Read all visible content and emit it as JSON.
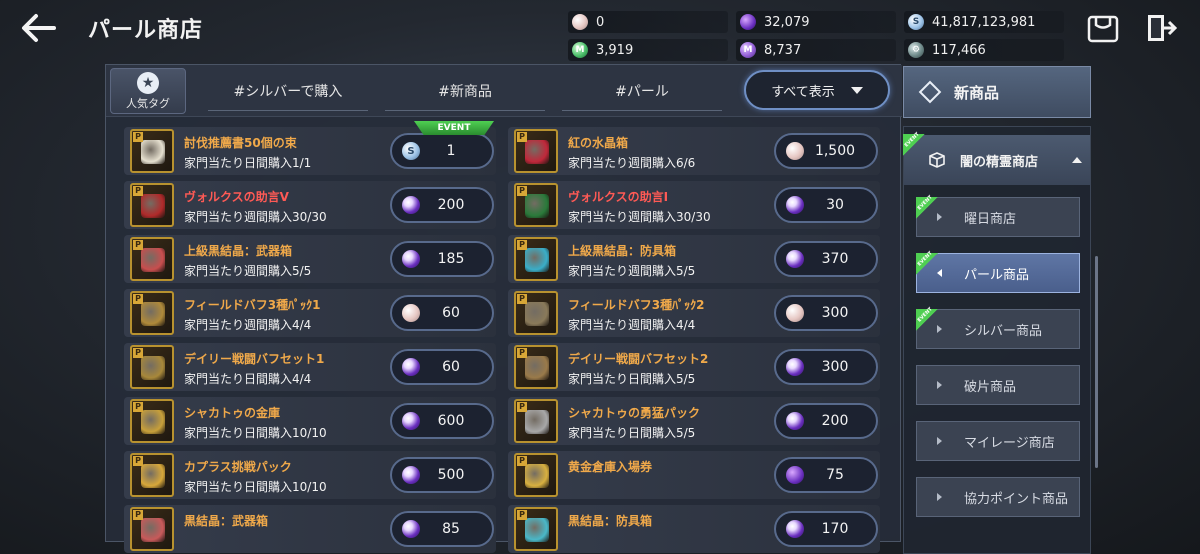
{
  "header": {
    "title": "パール商店",
    "currencies": [
      {
        "icon": "pearl-icon",
        "value": "0"
      },
      {
        "icon": "dark-crystal-icon",
        "value": "32,079"
      },
      {
        "icon": "silver-icon",
        "value": "41,817,123,981"
      },
      {
        "icon": "mileage-icon",
        "value": "3,919"
      },
      {
        "icon": "purple-coin-icon",
        "value": "8,737"
      },
      {
        "icon": "gear-coin-icon",
        "value": "117,466"
      }
    ]
  },
  "tags": {
    "popular_label": "人気タグ",
    "items": [
      "#シルバーで購入",
      "#新商品",
      "#パール"
    ],
    "show_all": "すべて表示"
  },
  "items": [
    {
      "name": "討伐推薦書50個の束",
      "limit": "家門当たり日間購入1/1",
      "price": "1",
      "currency": "silver",
      "event": "EVENT",
      "nameColor": "orange",
      "art": "#e6e0cf"
    },
    {
      "name": "紅の水晶箱",
      "limit": "家門当たり週間購入6/6",
      "price": "1,500",
      "currency": "pearl",
      "nameColor": "orange",
      "art": "#c0283a"
    },
    {
      "name": "ヴォルクスの助言V",
      "limit": "家門当たり週間購入30/30",
      "price": "200",
      "currency": "purple",
      "nameColor": "red",
      "art": "#b02a2a"
    },
    {
      "name": "ヴォルクスの助言I",
      "limit": "家門当たり週間購入30/30",
      "price": "30",
      "currency": "purple",
      "nameColor": "red",
      "art": "#2a7a3a"
    },
    {
      "name": "上級黒結晶：武器箱",
      "limit": "家門当たり週間購入5/5",
      "price": "185",
      "currency": "purple",
      "nameColor": "orange",
      "art": "#c84e4e"
    },
    {
      "name": "上級黒結晶：防具箱",
      "limit": "家門当たり週間購入5/5",
      "price": "370",
      "currency": "purple",
      "nameColor": "orange",
      "art": "#3aaec8"
    },
    {
      "name": "フィールドバフ3種ﾊﾟｯｸ1",
      "limit": "家門当たり週間購入4/4",
      "price": "60",
      "currency": "pearl",
      "nameColor": "orange",
      "art": "#b08a3a"
    },
    {
      "name": "フィールドバフ3種ﾊﾟｯｸ2",
      "limit": "家門当たり週間購入4/4",
      "price": "300",
      "currency": "pearl",
      "nameColor": "orange",
      "art": "#8a7a5a"
    },
    {
      "name": "デイリー戦闘バフセット1",
      "limit": "家門当たり日間購入4/4",
      "price": "60",
      "currency": "purple",
      "nameColor": "orange",
      "art": "#a8883a"
    },
    {
      "name": "デイリー戦闘バフセット2",
      "limit": "家門当たり日間購入5/5",
      "price": "300",
      "currency": "purple",
      "nameColor": "orange",
      "art": "#9a7a4a"
    },
    {
      "name": "シャカトゥの金庫",
      "limit": "家門当たり日間購入10/10",
      "price": "600",
      "currency": "purple",
      "nameColor": "orange",
      "art": "#c8a03a"
    },
    {
      "name": "シャカトゥの勇猛パック",
      "limit": "家門当たり日間購入5/5",
      "price": "200",
      "currency": "purple",
      "nameColor": "orange",
      "art": "#a8a8a8"
    },
    {
      "name": "カプラス挑戦パック",
      "limit": "家門当たり日間購入10/10",
      "price": "500",
      "currency": "purple",
      "nameColor": "orange",
      "art": "#d8a83a"
    },
    {
      "name": "黄金倉庫入場券",
      "limit": "",
      "price": "75",
      "currency": "dark",
      "nameColor": "orange",
      "art": "#d8b040"
    },
    {
      "name": "黒結晶：武器箱",
      "limit": "",
      "price": "85",
      "currency": "purple",
      "nameColor": "orange",
      "art": "#c85a5a"
    },
    {
      "name": "黒結晶：防具箱",
      "limit": "",
      "price": "170",
      "currency": "purple",
      "nameColor": "orange",
      "art": "#4ab8c8"
    }
  ],
  "side": {
    "new_items": "新商品",
    "dark_shop": "闇の精霊商店",
    "event_tag": "EVENT",
    "subs": [
      {
        "label": "曜日商店",
        "event": true,
        "active": false
      },
      {
        "label": "パール商品",
        "event": true,
        "active": true
      },
      {
        "label": "シルバー商品",
        "event": true,
        "active": false
      },
      {
        "label": "破片商品",
        "event": false,
        "active": false
      },
      {
        "label": "マイレージ商店",
        "event": false,
        "active": false
      },
      {
        "label": "協力ポイント商品",
        "event": false,
        "active": false
      }
    ]
  },
  "colors": {
    "accent": "#6f8fc4",
    "orange_name": "#f0a94a",
    "red_name": "#ff5a55",
    "event_green": "#4fcf52"
  }
}
